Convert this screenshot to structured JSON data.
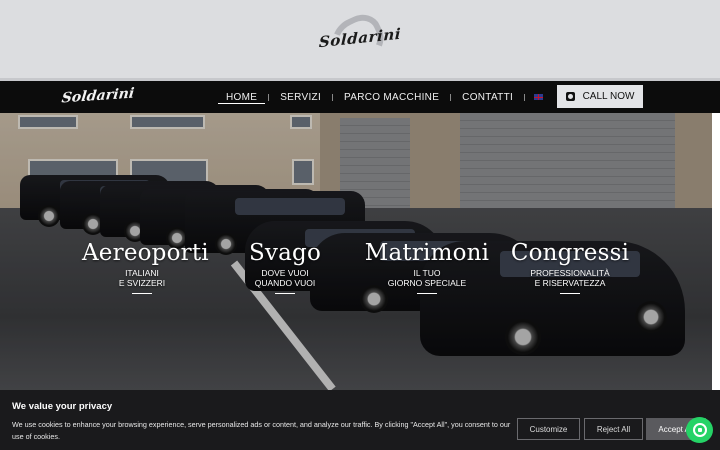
{
  "header": {
    "logo_text": "Soldarini"
  },
  "navbar": {
    "logo_text": "Soldarini",
    "items": [
      {
        "label": "HOME",
        "active": true
      },
      {
        "label": "SERVIZI",
        "active": false
      },
      {
        "label": "PARCO MACCHINE",
        "active": false
      },
      {
        "label": "CONTATTI",
        "active": false
      }
    ],
    "language_icon": "uk-flag-icon",
    "map_icon": "map-icon",
    "call_button": {
      "label": "CALL NOW",
      "icon": "phone-icon"
    }
  },
  "hero": {
    "categories": [
      {
        "title": "Aereoporti",
        "sub_line1": "ITALIANI",
        "sub_line2": "E SVIZZERI"
      },
      {
        "title": "Svago",
        "sub_line1": "DOVE VUOI",
        "sub_line2": "QUANDO VUOI"
      },
      {
        "title": "Matrimoni",
        "sub_line1": "IL TUO",
        "sub_line2": "GIORNO SPECIALE"
      },
      {
        "title": "Congressi",
        "sub_line1": "PROFESSIONALITÀ",
        "sub_line2": "E RISERVATEZZA"
      }
    ]
  },
  "cookie_banner": {
    "title": "We value your privacy",
    "text": "We use cookies to enhance your browsing experience, serve personalized ads or content, and analyze our traffic. By clicking \"Accept All\", you consent to our use of cookies.",
    "customize_label": "Customize",
    "reject_label": "Reject All",
    "accept_label": "Accept All"
  },
  "whatsapp": {
    "icon": "whatsapp-icon"
  },
  "colors": {
    "navbar_bg": "#0c0c0c",
    "topbar_bg": "#dcdde0",
    "call_button_bg": "#e3e4e7",
    "whatsapp_green": "#25d366",
    "cookie_bg": "#1a1a1c"
  }
}
